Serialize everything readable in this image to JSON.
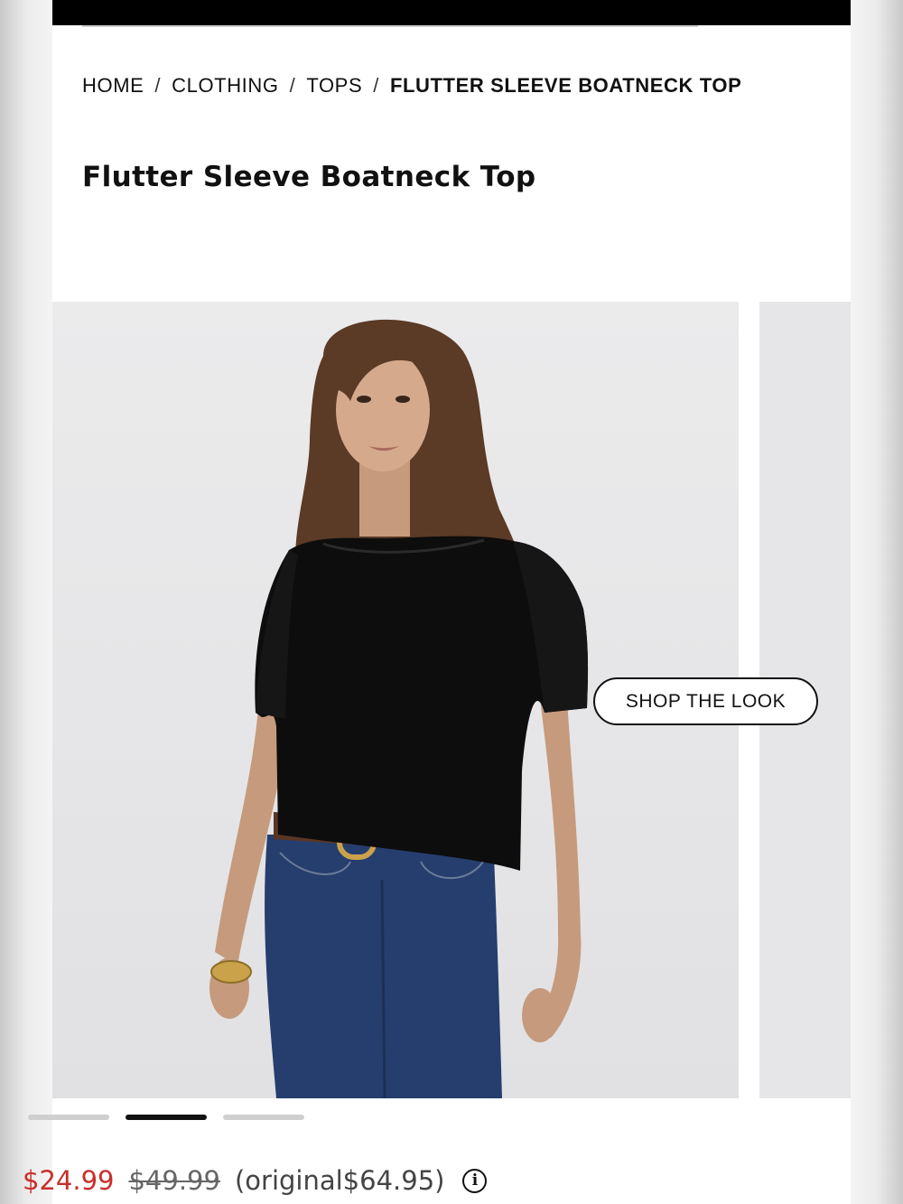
{
  "breadcrumb": {
    "items": [
      {
        "label": "HOME"
      },
      {
        "label": "CLOTHING"
      },
      {
        "label": "TOPS"
      },
      {
        "label": "FLUTTER SLEEVE BOATNECK TOP"
      }
    ],
    "separator": "/"
  },
  "product": {
    "title": "Flutter Sleeve Boatneck Top"
  },
  "gallery": {
    "shop_the_look_label": "SHOP THE LOOK",
    "active_slide": 2,
    "slide_count": 3
  },
  "price": {
    "sale": "$24.99",
    "was": "$49.99",
    "original": "(original$64.95)",
    "info_icon": "info-icon"
  },
  "colors": {
    "sale_price": "#c8302b",
    "top_bar": "#000000",
    "active_dot": "#111111",
    "inactive_dot": "#cfcfcf"
  }
}
